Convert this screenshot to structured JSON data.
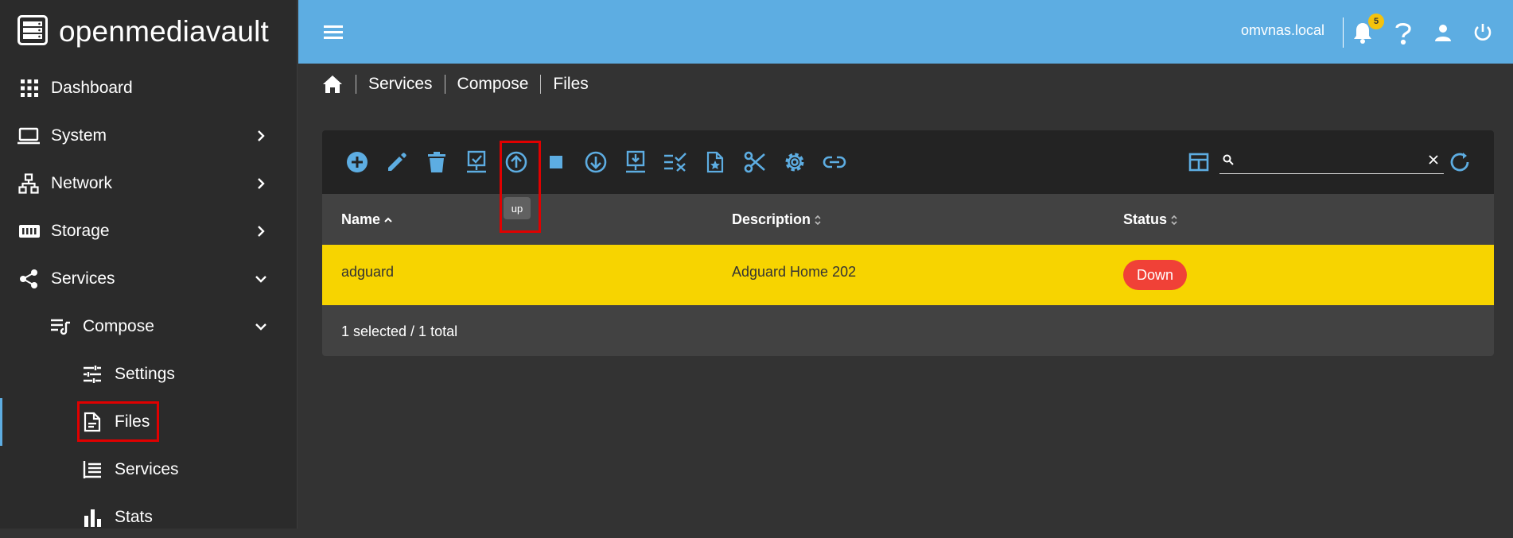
{
  "brand": {
    "name": "openmediavault"
  },
  "sidebar": {
    "items": [
      {
        "label": "Dashboard",
        "icon": "grid-icon"
      },
      {
        "label": "System",
        "icon": "laptop-icon"
      },
      {
        "label": "Network",
        "icon": "network-icon"
      },
      {
        "label": "Storage",
        "icon": "storage-icon"
      },
      {
        "label": "Services",
        "icon": "share-icon"
      },
      {
        "label": "Compose",
        "icon": "compose-icon"
      },
      {
        "label": "Settings",
        "icon": "tune-icon"
      },
      {
        "label": "Files",
        "icon": "file-icon"
      },
      {
        "label": "Services",
        "icon": "list-icon"
      },
      {
        "label": "Stats",
        "icon": "bar-chart-icon"
      }
    ]
  },
  "header": {
    "hostname": "omvnas.local",
    "notification_count": "5"
  },
  "breadcrumb": [
    "Services",
    "Compose",
    "Files"
  ],
  "toolbar": {
    "tooltip": "up",
    "search": {
      "value": "",
      "placeholder": ""
    }
  },
  "table": {
    "columns": [
      "Name",
      "Description",
      "Status"
    ],
    "rows": [
      {
        "name": "adguard",
        "description": "Adguard Home 202",
        "status": "Down"
      }
    ],
    "footer": "1 selected / 1 total"
  },
  "colors": {
    "accent": "#5dade2",
    "sidebar_bg": "#2b2b2b",
    "content_bg": "#333333",
    "selected_row": "#f7d400",
    "status_down": "#f04137",
    "highlight": "#e00000"
  }
}
